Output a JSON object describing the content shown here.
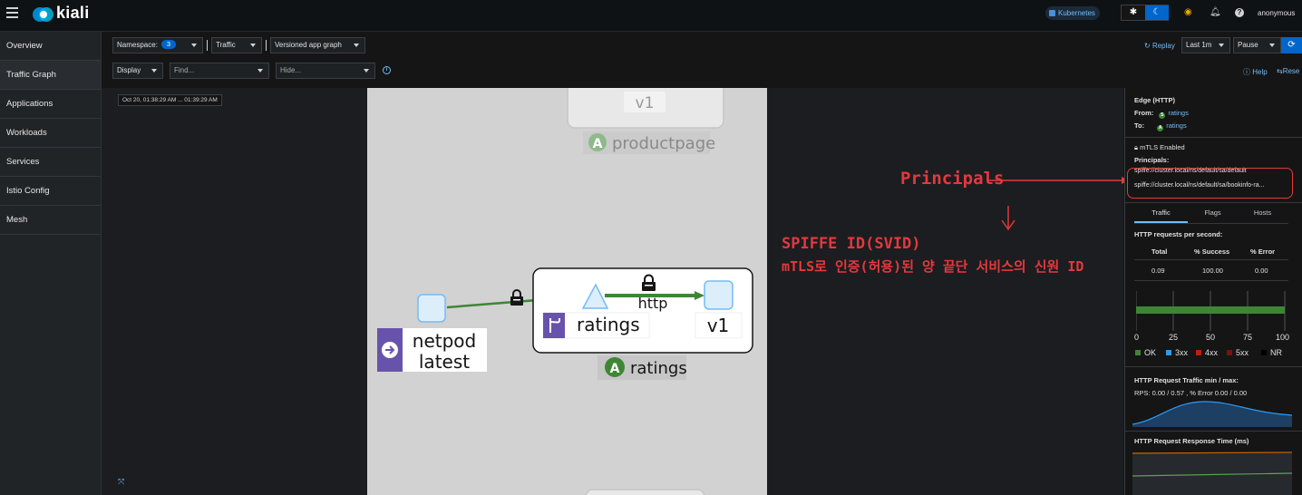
{
  "masthead": {
    "brand": "kiali",
    "cluster_chip": "Kubernetes",
    "user": "anonymous"
  },
  "sidebar": {
    "items": [
      {
        "label": "Overview"
      },
      {
        "label": "Traffic Graph",
        "active": true
      },
      {
        "label": "Applications"
      },
      {
        "label": "Workloads"
      },
      {
        "label": "Services"
      },
      {
        "label": "Istio Config"
      },
      {
        "label": "Mesh"
      }
    ]
  },
  "toolbar": {
    "namespace_label": "Namespace:",
    "namespace_count": "3",
    "traffic_label": "Traffic",
    "graph_type": "Versioned app graph",
    "display_label": "Display",
    "find_placeholder": "Find...",
    "hide_placeholder": "Hide...",
    "replay_label": "Replay",
    "duration": "Last 1m",
    "refresh_interval": "Pause",
    "help_label": "Help",
    "reset_label": "Rese"
  },
  "graph": {
    "timestamp": "Oct 20, 01:38:29 AM ... 01:39:29 AM",
    "nodes": {
      "top_version": "v1",
      "top_app": "productpage",
      "source_name_line1": "netpod",
      "source_name_line2": "latest",
      "service_name": "ratings",
      "edge_protocol": "http",
      "target_version": "v1",
      "app_box": "ratings",
      "app_badge": "A"
    },
    "annotation_principals": "Principals",
    "annotation_line1": "SPIFFE ID(SVID)",
    "annotation_line2": "mTLS로 인증(허용)된 양 끝단 서비스의 신원 ID",
    "annotation_color": "#e5383b"
  },
  "panel": {
    "title": "Edge (HTTP)",
    "from_label": "From:",
    "from_value": "ratings",
    "from_badge": "S",
    "to_label": "To:",
    "to_value": "ratings",
    "to_badge": "A",
    "mtls": "mTLS Enabled",
    "principals_label": "Principals:",
    "principal_1": "spiffe://cluster.local/ns/default/sa/default",
    "principal_2": "spiffe://cluster.local/ns/default/sa/bookinfo-ra...",
    "tabs": [
      "Traffic",
      "Flags",
      "Hosts"
    ],
    "rps_title": "HTTP requests per second:",
    "table_headers": [
      "Total",
      "% Success",
      "% Error"
    ],
    "table_values": [
      "0.09",
      "100.00",
      "0.00"
    ],
    "axis_ticks": [
      "0",
      "25",
      "50",
      "75",
      "100"
    ],
    "legend": [
      {
        "label": "OK",
        "color": "#3e8635"
      },
      {
        "label": "3xx",
        "color": "#2b9af3"
      },
      {
        "label": "4xx",
        "color": "#c9190b"
      },
      {
        "label": "5xx",
        "color": "#7d1007"
      },
      {
        "label": "NR",
        "color": "#000000"
      }
    ],
    "ok_percent": 100,
    "traffic_title": "HTTP Request Traffic min / max:",
    "traffic_values": "RPS: 0.00 / 0.57 , % Error 0.00 / 0.00",
    "response_title": "HTTP Request Response Time (ms)"
  }
}
